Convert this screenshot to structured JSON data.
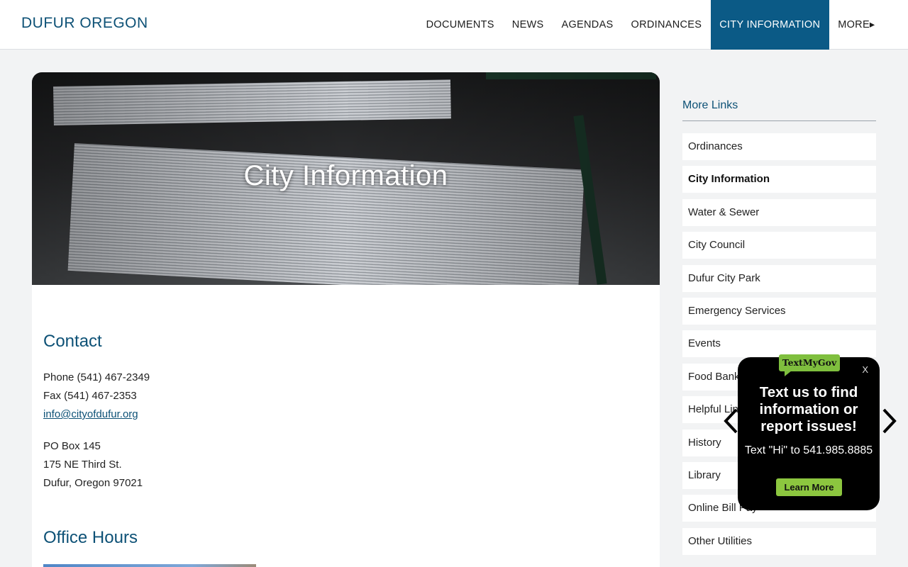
{
  "header": {
    "site_title": "DUFUR OREGON",
    "nav": [
      {
        "label": "DOCUMENTS"
      },
      {
        "label": "NEWS"
      },
      {
        "label": "AGENDAS"
      },
      {
        "label": "ORDINANCES"
      },
      {
        "label": "CITY INFORMATION",
        "active": true
      },
      {
        "label": "MORE▸"
      }
    ]
  },
  "hero": {
    "title": "City Information"
  },
  "contact": {
    "heading": "Contact",
    "phone": "Phone (541) 467-2349",
    "fax": "Fax (541) 467-2353",
    "email": "info@cityofdufur.org",
    "po_box": "PO Box 145",
    "street": "175 NE Third St.",
    "city": "Dufur, Oregon 97021"
  },
  "office_hours": {
    "heading": "Office Hours"
  },
  "sidebar": {
    "title": "More Links",
    "links": [
      {
        "label": "Ordinances"
      },
      {
        "label": "City Information",
        "active": true
      },
      {
        "label": "Water & Sewer"
      },
      {
        "label": "City Council"
      },
      {
        "label": "Dufur City Park"
      },
      {
        "label": "Emergency Services"
      },
      {
        "label": "Events"
      },
      {
        "label": "Food Bank"
      },
      {
        "label": "Helpful Links"
      },
      {
        "label": "History"
      },
      {
        "label": "Library"
      },
      {
        "label": "Online Bill Pay"
      },
      {
        "label": "Other Utilities"
      }
    ]
  },
  "textmygov": {
    "logo": "TextMyGov",
    "close": "X",
    "headline": "Text us to find information or report issues!",
    "sub": "Text \"Hi\" to 541.985.8885",
    "button": "Learn More"
  },
  "colors": {
    "brand": "#0d5176",
    "nav_active": "#0b5a86",
    "widget_green": "#8cc63f"
  }
}
